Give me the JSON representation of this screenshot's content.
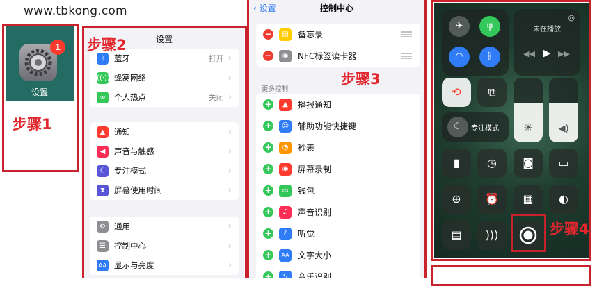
{
  "watermark": "www.tbkong.com",
  "steps": {
    "s1": "步骤1",
    "s2": "步骤2",
    "s3": "步骤3",
    "s4": "步骤4"
  },
  "colors": {
    "highlight": "#c8232c",
    "step_text": "#e0282e",
    "ios_blue": "#2f7cf6"
  },
  "panel1": {
    "app_label": "设置",
    "badge_count": "1",
    "icon": "gear-icon"
  },
  "panel2": {
    "title": "设置",
    "group1": [
      {
        "label": "蓝牙",
        "value": "打开",
        "icon": "bluetooth-icon",
        "color": "#2f7cf6",
        "glyph": "ᛒ"
      },
      {
        "label": "蜂窝网络",
        "value": "",
        "icon": "antenna-icon",
        "color": "#34c759",
        "glyph": "⚲"
      },
      {
        "label": "个人热点",
        "value": "关闭",
        "icon": "hotspot-icon",
        "color": "#34c759",
        "glyph": "∞"
      }
    ],
    "group2": [
      {
        "label": "通知",
        "icon": "bell-icon",
        "color": "#ff3b30",
        "glyph": "🔔"
      },
      {
        "label": "声音与触感",
        "icon": "speaker-icon",
        "color": "#ff2d55",
        "glyph": "◀"
      },
      {
        "label": "专注模式",
        "icon": "moon-icon",
        "color": "#5856d6",
        "glyph": "☾"
      },
      {
        "label": "屏幕使用时间",
        "icon": "hourglass-icon",
        "color": "#5856d6",
        "glyph": "⧗"
      }
    ],
    "group3": [
      {
        "label": "通用",
        "icon": "gear-icon",
        "color": "#8e8e93",
        "glyph": "⚙"
      },
      {
        "label": "控制中心",
        "icon": "switches-icon",
        "color": "#8e8e93",
        "glyph": "☰"
      },
      {
        "label": "显示与亮度",
        "icon": "text-size-icon",
        "color": "#2f7cf6",
        "glyph": "AA"
      }
    ]
  },
  "panel3": {
    "back_label": "设置",
    "title": "控制中心",
    "section_header": "更多控制",
    "included": [
      {
        "label": "备忘录",
        "icon": "notes-icon",
        "color": "#ffcc00",
        "glyph": "▤"
      },
      {
        "label": "NFC标签读卡器",
        "icon": "nfc-icon",
        "color": "#8e8e93",
        "glyph": "◉"
      }
    ],
    "more": [
      {
        "label": "播报通知",
        "icon": "announce-bell-icon",
        "color": "#ff3b30",
        "glyph": "🔔"
      },
      {
        "label": "辅助功能快捷键",
        "icon": "accessibility-icon",
        "color": "#2f7cf6",
        "glyph": "♿"
      },
      {
        "label": "秒表",
        "icon": "stopwatch-icon",
        "color": "#ff9500",
        "glyph": "◔"
      },
      {
        "label": "屏幕录制",
        "icon": "screen-record-icon",
        "color": "#ff3b30",
        "glyph": "◉"
      },
      {
        "label": "钱包",
        "icon": "wallet-icon",
        "color": "#34c759",
        "glyph": "▭"
      },
      {
        "label": "声音识别",
        "icon": "sound-recognition-icon",
        "color": "#ff2d55",
        "glyph": "♫"
      },
      {
        "label": "听觉",
        "icon": "ear-icon",
        "color": "#2f7cf6",
        "glyph": "ℓ"
      },
      {
        "label": "文字大小",
        "icon": "text-size-icon",
        "color": "#2f7cf6",
        "glyph": "AA"
      },
      {
        "label": "音乐识别",
        "icon": "shazam-icon",
        "color": "#2f7cf6",
        "glyph": "S"
      }
    ]
  },
  "panel4": {
    "now_playing": "未在播放",
    "focus_label": "专注模式"
  }
}
